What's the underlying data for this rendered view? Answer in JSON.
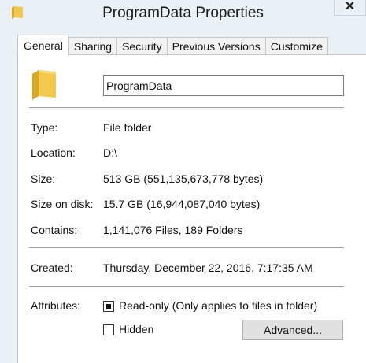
{
  "window": {
    "title": "ProgramData Properties",
    "close_glyph": "✕",
    "title_icon": "folder-icon"
  },
  "tabs": [
    {
      "label": "General",
      "active": true
    },
    {
      "label": "Sharing",
      "active": false
    },
    {
      "label": "Security",
      "active": false
    },
    {
      "label": "Previous Versions",
      "active": false
    },
    {
      "label": "Customize",
      "active": false
    }
  ],
  "general": {
    "folder_icon": "folder-icon",
    "name_value": "ProgramData",
    "rows": [
      {
        "label": "Type:",
        "value": "File folder"
      },
      {
        "label": "Location:",
        "value": "D:\\"
      },
      {
        "label": "Size:",
        "value": "513 GB (551,135,673,778 bytes)"
      },
      {
        "label": "Size on disk:",
        "value": "15.7 GB (16,944,087,040 bytes)"
      },
      {
        "label": "Contains:",
        "value": "1,141,076 Files, 189 Folders"
      }
    ],
    "created": {
      "label": "Created:",
      "value": "Thursday, December 22, 2016, 7:17:35 AM"
    },
    "attributes": {
      "label": "Attributes:",
      "read_only": {
        "label": "Read-only (Only applies to files in folder)",
        "state": "indeterminate"
      },
      "hidden": {
        "label": "Hidden",
        "checked": false
      },
      "advanced_label": "Advanced..."
    }
  },
  "colors": {
    "window_bg": "#e9f1f7",
    "panel_bg": "#ffffff",
    "folder_yellow": "#f2c94c"
  }
}
